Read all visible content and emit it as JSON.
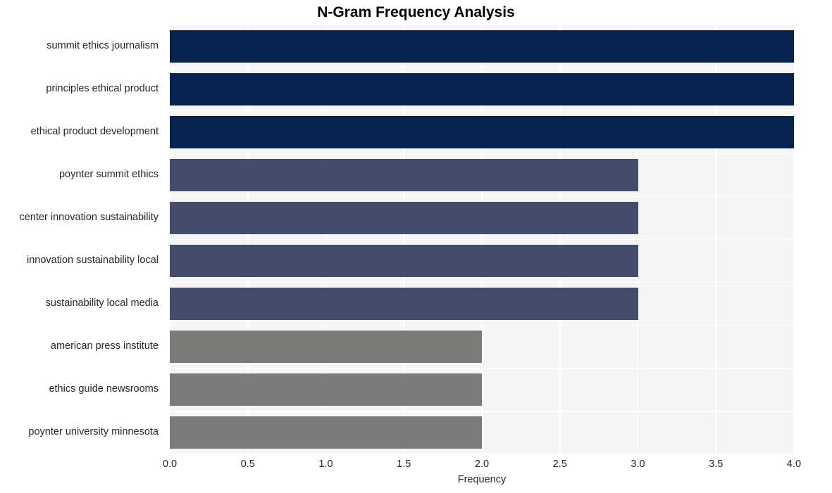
{
  "chart_data": {
    "type": "bar",
    "orientation": "horizontal",
    "title": "N-Gram Frequency Analysis",
    "xlabel": "Frequency",
    "ylabel": "",
    "xlim": [
      0,
      4.0
    ],
    "xticks": [
      "0.0",
      "0.5",
      "1.0",
      "1.5",
      "2.0",
      "2.5",
      "3.0",
      "3.5",
      "4.0"
    ],
    "xtick_values": [
      0,
      0.5,
      1.0,
      1.5,
      2.0,
      2.5,
      3.0,
      3.5,
      4.0
    ],
    "grid": true,
    "legend": "none",
    "categories": [
      "summit ethics journalism",
      "principles ethical product",
      "ethical product development",
      "poynter summit ethics",
      "center innovation sustainability",
      "innovation sustainability local",
      "sustainability local media",
      "american press institute",
      "ethics guide newsrooms",
      "poynter university minnesota"
    ],
    "values": [
      4,
      4,
      4,
      3,
      3,
      3,
      3,
      2,
      2,
      2
    ],
    "bar_colors": [
      "#06234f",
      "#06234f",
      "#06234f",
      "#434c6b",
      "#434c6b",
      "#434c6b",
      "#434c6b",
      "#7c7b78",
      "#7c7b78",
      "#7c7b78"
    ]
  },
  "colors": {
    "figure_background": "#ffffff",
    "axes_background": "#f5f5f5",
    "grid": "#ffffff",
    "title_text": "#000000",
    "tick_text": "#262626"
  }
}
